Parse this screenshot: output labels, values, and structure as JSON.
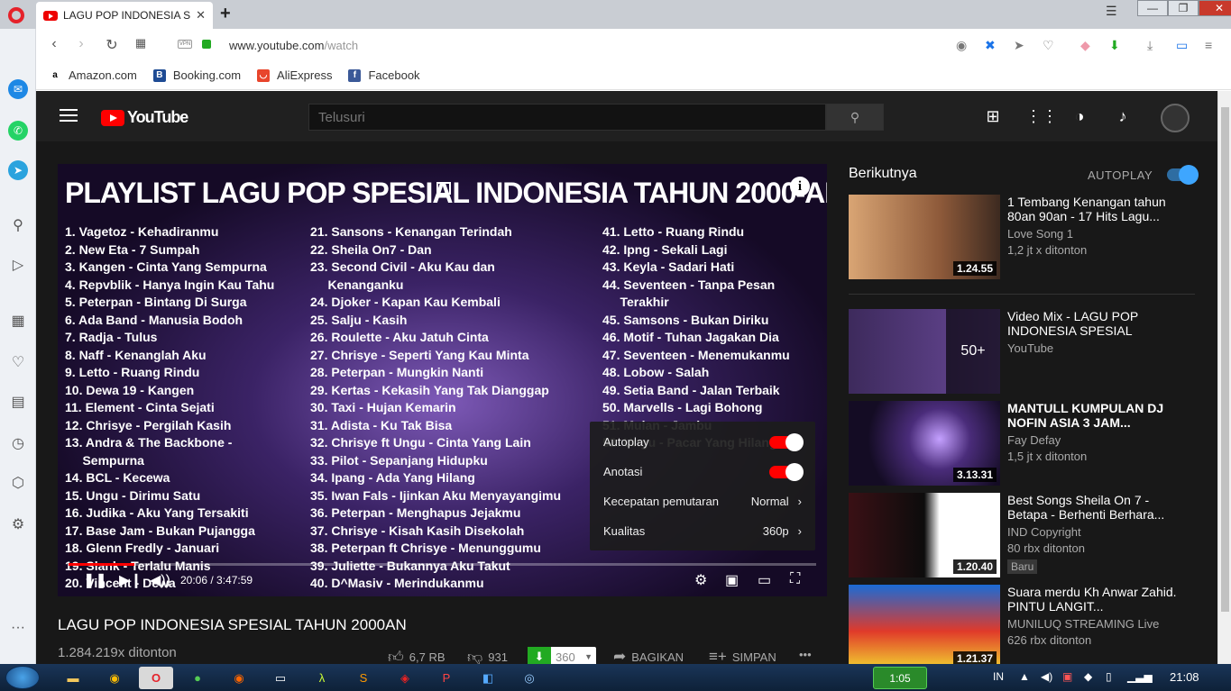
{
  "browser": {
    "tab_title": "LAGU POP INDONESIA SPES",
    "tab_close": "✕",
    "new_tab": "+",
    "url_domain": "www.youtube.com",
    "url_path": "/watch",
    "vpn_label": "VPN",
    "bookmarks": [
      {
        "label": "Amazon.com",
        "icon": "amazon-icon",
        "color": "#ffffff"
      },
      {
        "label": "Booking.com",
        "icon": "booking-icon",
        "color": "#1e4b94"
      },
      {
        "label": "AliExpress",
        "icon": "aliexpress-icon",
        "color": "#e8452c"
      },
      {
        "label": "Facebook",
        "icon": "facebook-icon",
        "color": "#3b5998"
      }
    ]
  },
  "youtube": {
    "logo_text": "YouTube",
    "search_placeholder": "Telusuri",
    "player": {
      "overlay_title": "PLAYLIST LAGU POP SPESIAL INDONESIA TAHUN 2000-AN",
      "col1": [
        "1. Vagetoz - Kehadiranmu",
        "2. New Eta - 7 Sumpah",
        "3. Kangen - Cinta Yang Sempurna",
        "4. Repvblik - Hanya Ingin Kau Tahu",
        "5. Peterpan - Bintang Di Surga",
        "6. Ada Band - Manusia Bodoh",
        "7. Radja - Tulus",
        "8. Naff - Kenanglah Aku",
        "9. Letto - Ruang Rindu",
        "10. Dewa 19 - Kangen",
        "11. Element - Cinta Sejati",
        "12. Chrisye - Pergilah Kasih",
        "13. Andra & The Backbone -",
        "     Sempurna",
        "14. BCL - Kecewa",
        "15. Ungu - Dirimu Satu",
        "16. Judika - Aku Yang Tersakiti",
        "17. Base Jam - Bukan Pujangga",
        "18. Glenn Fredly - Januari",
        "19. Slank - Terlalu Manis",
        "20. Vincent - Dewa"
      ],
      "col2": [
        "21. Sansons - Kenangan Terindah",
        "22. Sheila On7 - Dan",
        "23. Second Civil - Aku Kau dan",
        "     Kenanganku",
        "24. Djoker - Kapan Kau Kembali",
        "25. Salju - Kasih",
        "26. Roulette - Aku Jatuh Cinta",
        "27. Chrisye - Seperti Yang Kau Minta",
        "28. Peterpan - Mungkin Nanti",
        "29. Kertas - Kekasih Yang Tak Dianggap",
        "30. Taxi - Hujan Kemarin",
        "31. Adista - Ku Tak Bisa",
        "32. Chrisye ft Ungu - Cinta Yang Lain",
        "33. Pilot - Sepanjang Hidupku",
        "34. Ipang - Ada Yang Hilang",
        "35. Iwan Fals - Ijinkan Aku Menyayangimu",
        "36. Peterpan - Menghapus Jejakmu",
        "37. Chrisye - Kisah Kasih Disekolah",
        "38. Peterpan ft Chrisye - Menunggumu",
        "39. Juliette - Bukannya Aku Takut",
        "40. D^Masiv - Merindukanmu"
      ],
      "col3": [
        "41. Letto - Ruang Rindu",
        "42. Ipng - Sekali Lagi",
        "43. Keyla - Sadari Hati",
        "44. Seventeen - Tanpa Pesan",
        "     Terakhir",
        "45. Samsons - Bukan Diriku",
        "46. Motif - Tuhan Jagakan Dia",
        "47. Seventeen - Menemukanmu",
        "48. Lobow - Salah",
        "49. Setia Band - Jalan Terbaik",
        "50. Marvells - Lagi Bohong",
        "51. Mulan - Jambu",
        "52. Ungu - Pacar Yang Hilang"
      ],
      "settings": {
        "autoplay": "Autoplay",
        "annotations": "Anotasi",
        "speed_label": "Kecepatan pemutaran",
        "speed_value": "Normal",
        "quality_label": "Kualitas",
        "quality_value": "360p"
      },
      "time": "20:06 / 3:47:59",
      "progress": 0.088
    },
    "video_title": "LAGU POP INDONESIA SPESIAL TAHUN 2000AN",
    "views": "1.284.219x ditonton",
    "likes": "6,7 RB",
    "dislikes": "931",
    "download_quality": "360",
    "share": "BAGIKAN",
    "save": "SIMPAN",
    "more": "•••",
    "up_next": "Berikutnya",
    "autoplay_label": "AUTOPLAY",
    "recommendations": [
      {
        "title": "1 Tembang Kenangan tahun 80an 90an - 17 Hits Lagu...",
        "channel": "Love Song 1",
        "views": "1,2 jt x ditonton",
        "duration": "1.24.55",
        "thumb_color": "#c79a6a"
      },
      {
        "title": "Video Mix - LAGU POP INDONESIA SPESIAL TAHUN...",
        "channel": "YouTube",
        "views": "",
        "duration": "50+",
        "thumb_color": "#3d2a5c"
      },
      {
        "title": "MANTULL KUMPULAN DJ NOFIN ASIA 3 JAM...",
        "channel": "Fay Defay",
        "views": "1,5 jt x ditonton",
        "duration": "3.13.31",
        "thumb_color": "#1c1333"
      },
      {
        "title": "Best Songs Sheila On 7 - Betapa - Berhenti Berhara...",
        "channel": "IND Copyright",
        "views": "80 rbx ditonton",
        "duration": "1.20.40",
        "badge": "Baru",
        "thumb_color": "#2a0f12"
      },
      {
        "title": "Suara merdu Kh Anwar Zahid. PINTU LANGIT...",
        "channel": "MUNILUQ STREAMING Live",
        "views": "626 rbx ditonton",
        "duration": "1.21.37",
        "thumb_color": "#b8302a"
      }
    ]
  },
  "taskbar": {
    "clock": "21:08",
    "lang": "IN",
    "timer": "1:05"
  }
}
